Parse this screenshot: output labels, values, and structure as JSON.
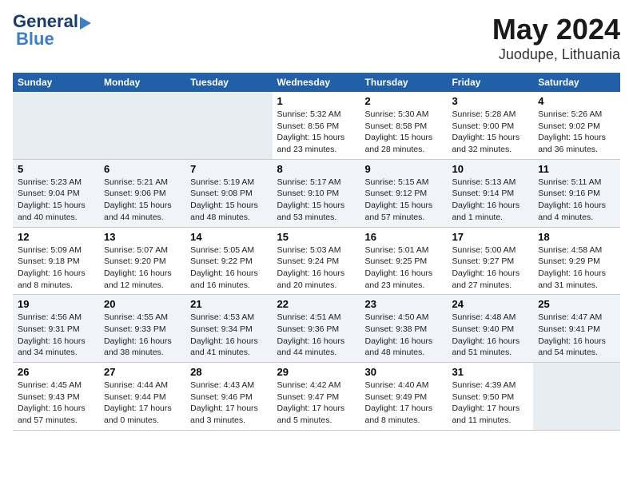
{
  "header": {
    "logo_line1": "General",
    "logo_line2": "Blue",
    "title": "May 2024",
    "subtitle": "Juodupe, Lithuania"
  },
  "days_of_week": [
    "Sunday",
    "Monday",
    "Tuesday",
    "Wednesday",
    "Thursday",
    "Friday",
    "Saturday"
  ],
  "weeks": [
    [
      {
        "num": "",
        "info": ""
      },
      {
        "num": "",
        "info": ""
      },
      {
        "num": "",
        "info": ""
      },
      {
        "num": "1",
        "info": "Sunrise: 5:32 AM\nSunset: 8:56 PM\nDaylight: 15 hours\nand 23 minutes."
      },
      {
        "num": "2",
        "info": "Sunrise: 5:30 AM\nSunset: 8:58 PM\nDaylight: 15 hours\nand 28 minutes."
      },
      {
        "num": "3",
        "info": "Sunrise: 5:28 AM\nSunset: 9:00 PM\nDaylight: 15 hours\nand 32 minutes."
      },
      {
        "num": "4",
        "info": "Sunrise: 5:26 AM\nSunset: 9:02 PM\nDaylight: 15 hours\nand 36 minutes."
      }
    ],
    [
      {
        "num": "5",
        "info": "Sunrise: 5:23 AM\nSunset: 9:04 PM\nDaylight: 15 hours\nand 40 minutes."
      },
      {
        "num": "6",
        "info": "Sunrise: 5:21 AM\nSunset: 9:06 PM\nDaylight: 15 hours\nand 44 minutes."
      },
      {
        "num": "7",
        "info": "Sunrise: 5:19 AM\nSunset: 9:08 PM\nDaylight: 15 hours\nand 48 minutes."
      },
      {
        "num": "8",
        "info": "Sunrise: 5:17 AM\nSunset: 9:10 PM\nDaylight: 15 hours\nand 53 minutes."
      },
      {
        "num": "9",
        "info": "Sunrise: 5:15 AM\nSunset: 9:12 PM\nDaylight: 15 hours\nand 57 minutes."
      },
      {
        "num": "10",
        "info": "Sunrise: 5:13 AM\nSunset: 9:14 PM\nDaylight: 16 hours\nand 1 minute."
      },
      {
        "num": "11",
        "info": "Sunrise: 5:11 AM\nSunset: 9:16 PM\nDaylight: 16 hours\nand 4 minutes."
      }
    ],
    [
      {
        "num": "12",
        "info": "Sunrise: 5:09 AM\nSunset: 9:18 PM\nDaylight: 16 hours\nand 8 minutes."
      },
      {
        "num": "13",
        "info": "Sunrise: 5:07 AM\nSunset: 9:20 PM\nDaylight: 16 hours\nand 12 minutes."
      },
      {
        "num": "14",
        "info": "Sunrise: 5:05 AM\nSunset: 9:22 PM\nDaylight: 16 hours\nand 16 minutes."
      },
      {
        "num": "15",
        "info": "Sunrise: 5:03 AM\nSunset: 9:24 PM\nDaylight: 16 hours\nand 20 minutes."
      },
      {
        "num": "16",
        "info": "Sunrise: 5:01 AM\nSunset: 9:25 PM\nDaylight: 16 hours\nand 23 minutes."
      },
      {
        "num": "17",
        "info": "Sunrise: 5:00 AM\nSunset: 9:27 PM\nDaylight: 16 hours\nand 27 minutes."
      },
      {
        "num": "18",
        "info": "Sunrise: 4:58 AM\nSunset: 9:29 PM\nDaylight: 16 hours\nand 31 minutes."
      }
    ],
    [
      {
        "num": "19",
        "info": "Sunrise: 4:56 AM\nSunset: 9:31 PM\nDaylight: 16 hours\nand 34 minutes."
      },
      {
        "num": "20",
        "info": "Sunrise: 4:55 AM\nSunset: 9:33 PM\nDaylight: 16 hours\nand 38 minutes."
      },
      {
        "num": "21",
        "info": "Sunrise: 4:53 AM\nSunset: 9:34 PM\nDaylight: 16 hours\nand 41 minutes."
      },
      {
        "num": "22",
        "info": "Sunrise: 4:51 AM\nSunset: 9:36 PM\nDaylight: 16 hours\nand 44 minutes."
      },
      {
        "num": "23",
        "info": "Sunrise: 4:50 AM\nSunset: 9:38 PM\nDaylight: 16 hours\nand 48 minutes."
      },
      {
        "num": "24",
        "info": "Sunrise: 4:48 AM\nSunset: 9:40 PM\nDaylight: 16 hours\nand 51 minutes."
      },
      {
        "num": "25",
        "info": "Sunrise: 4:47 AM\nSunset: 9:41 PM\nDaylight: 16 hours\nand 54 minutes."
      }
    ],
    [
      {
        "num": "26",
        "info": "Sunrise: 4:45 AM\nSunset: 9:43 PM\nDaylight: 16 hours\nand 57 minutes."
      },
      {
        "num": "27",
        "info": "Sunrise: 4:44 AM\nSunset: 9:44 PM\nDaylight: 17 hours\nand 0 minutes."
      },
      {
        "num": "28",
        "info": "Sunrise: 4:43 AM\nSunset: 9:46 PM\nDaylight: 17 hours\nand 3 minutes."
      },
      {
        "num": "29",
        "info": "Sunrise: 4:42 AM\nSunset: 9:47 PM\nDaylight: 17 hours\nand 5 minutes."
      },
      {
        "num": "30",
        "info": "Sunrise: 4:40 AM\nSunset: 9:49 PM\nDaylight: 17 hours\nand 8 minutes."
      },
      {
        "num": "31",
        "info": "Sunrise: 4:39 AM\nSunset: 9:50 PM\nDaylight: 17 hours\nand 11 minutes."
      },
      {
        "num": "",
        "info": ""
      }
    ]
  ]
}
